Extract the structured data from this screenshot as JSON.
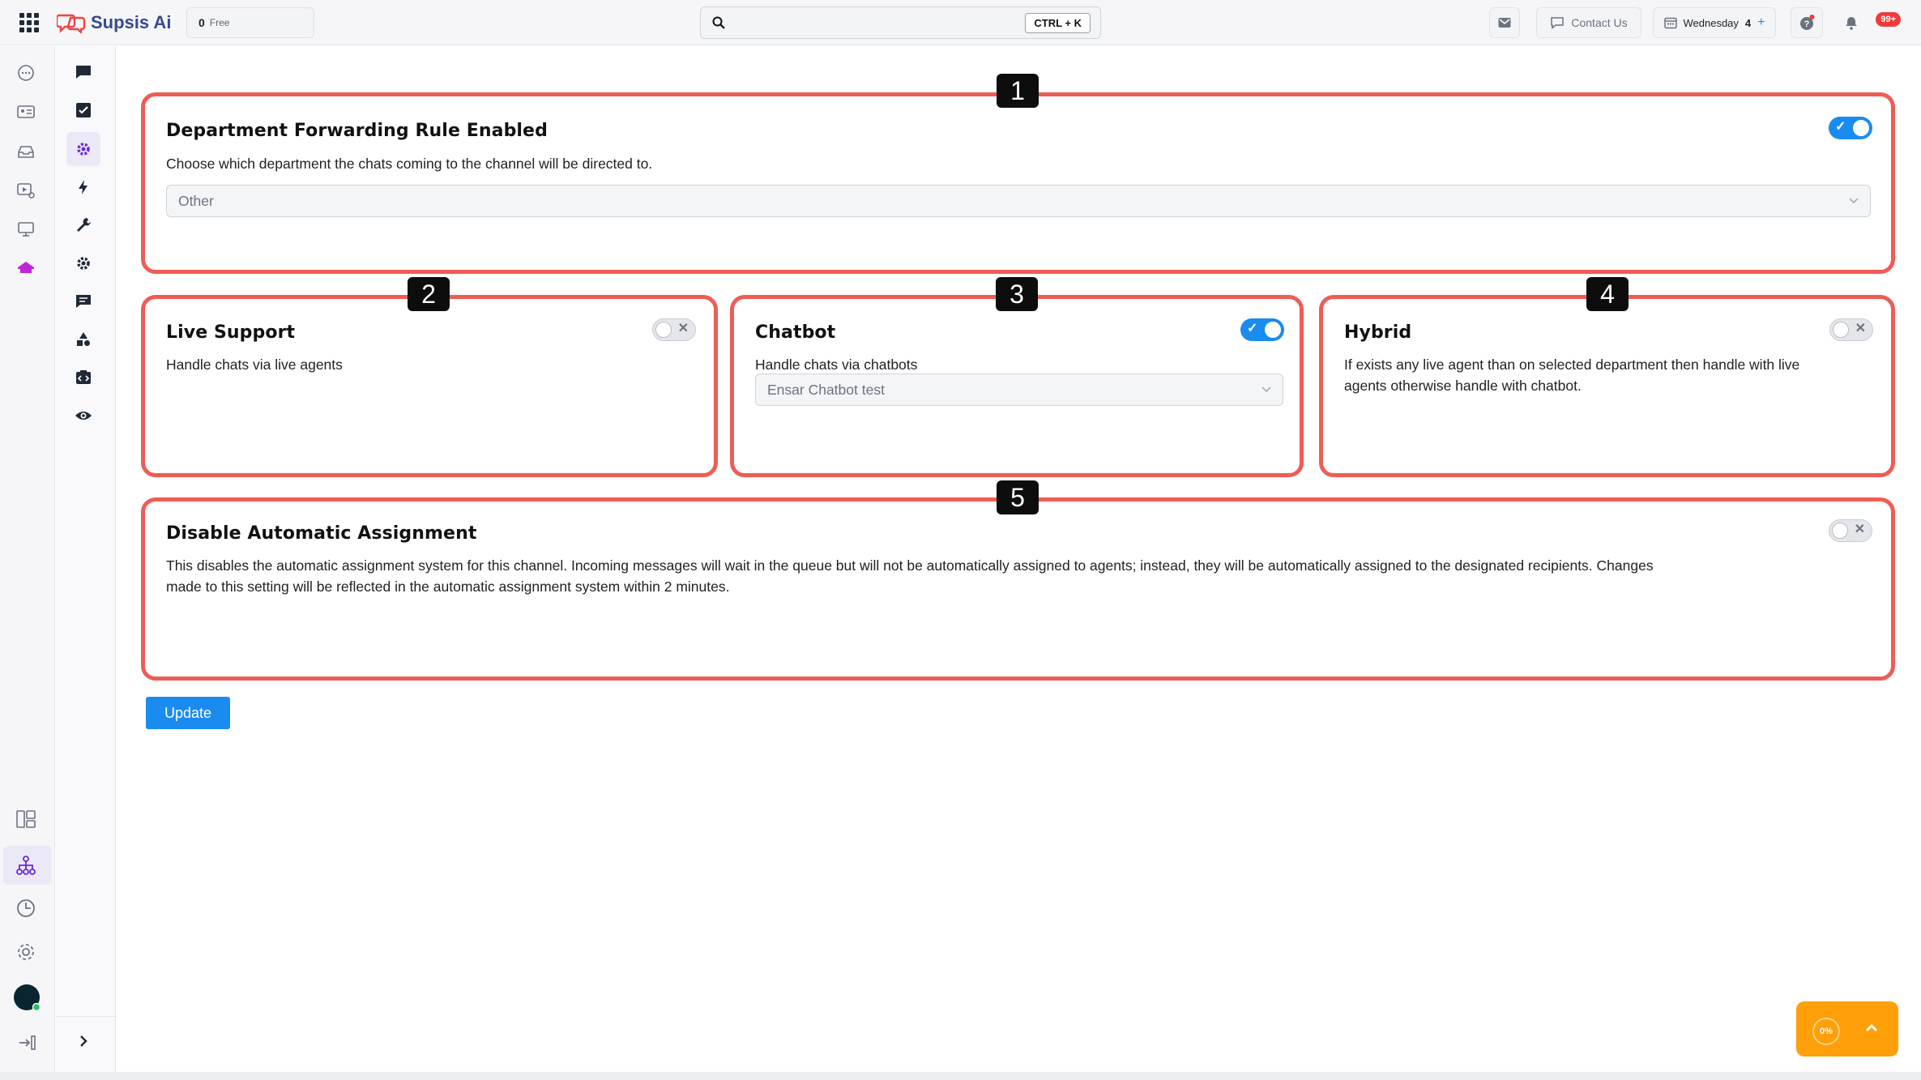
{
  "app": {
    "brand": "Supsis Ai",
    "credit_value": "0",
    "credit_label": "Free"
  },
  "header": {
    "search_shortcut": "CTRL + K",
    "contact_label": "Contact Us",
    "date_day": "Wednesday",
    "date_num": "4",
    "notif_count": "99+"
  },
  "cards": {
    "forwarding": {
      "badge": "1",
      "title": "Department Forwarding Rule Enabled",
      "desc": "Choose which department the chats coming to the channel will be directed to.",
      "select_value": "Other",
      "enabled": true
    },
    "live": {
      "badge": "2",
      "title": "Live Support",
      "desc": "Handle chats via live agents",
      "enabled": false
    },
    "chatbot": {
      "badge": "3",
      "title": "Chatbot",
      "desc": "Handle chats via chatbots",
      "select_value": "Ensar Chatbot test",
      "enabled": true
    },
    "hybrid": {
      "badge": "4",
      "title": "Hybrid",
      "desc_line1": "If exists any live agent than on selected department then handle with live",
      "desc_line2": "agents otherwise handle with chatbot.",
      "enabled": false
    },
    "disable": {
      "badge": "5",
      "title": "Disable Automatic Assignment",
      "desc_line1": "This disables the automatic assignment system for this channel. Incoming messages will wait in the queue but will not be automatically assigned to agents; instead, they will be automatically assigned to the designated recipients. Changes",
      "desc_line2": "made to this setting will be reflected in the automatic assignment system within 2 minutes.",
      "enabled": false
    }
  },
  "actions": {
    "update_label": "Update"
  },
  "progress_widget": {
    "percent_label": "0%",
    "percent": 0
  },
  "colors": {
    "accent": "#1a8bef",
    "highlight_border": "#ee5d55",
    "progress_bg": "#ff9f0a",
    "brand_text": "#374a8f"
  }
}
